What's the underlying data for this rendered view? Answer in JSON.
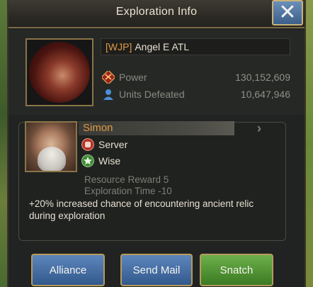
{
  "header": {
    "title": "Exploration Info",
    "close_icon": "close-x-icon"
  },
  "player": {
    "tag": "[WJP]",
    "name": "Angel E ATL",
    "stats": [
      {
        "icon": "power-icon",
        "label": "Power",
        "value": "130,152,609"
      },
      {
        "icon": "user-icon",
        "label": "Units Defeated",
        "value": "10,647,946"
      }
    ]
  },
  "hero": {
    "name": "Simon",
    "traits": [
      {
        "icon": "fist-icon",
        "label": "Server",
        "color": "#c0392b"
      },
      {
        "icon": "star-icon",
        "label": "Wise",
        "color": "#3f8a36"
      }
    ],
    "resource_reward": "Resource Reward 5",
    "exploration_time": "Exploration Time -10",
    "description": "+20% increased chance of encountering ancient relic during exploration"
  },
  "buttons": {
    "alliance": "Alliance",
    "send_mail": "Send Mail",
    "snatch": "Snatch"
  },
  "colors": {
    "accent_orange": "#e09a45",
    "button_blue": "#33598c",
    "button_green": "#3c7a24",
    "frame_gold": "#b59a5e"
  }
}
